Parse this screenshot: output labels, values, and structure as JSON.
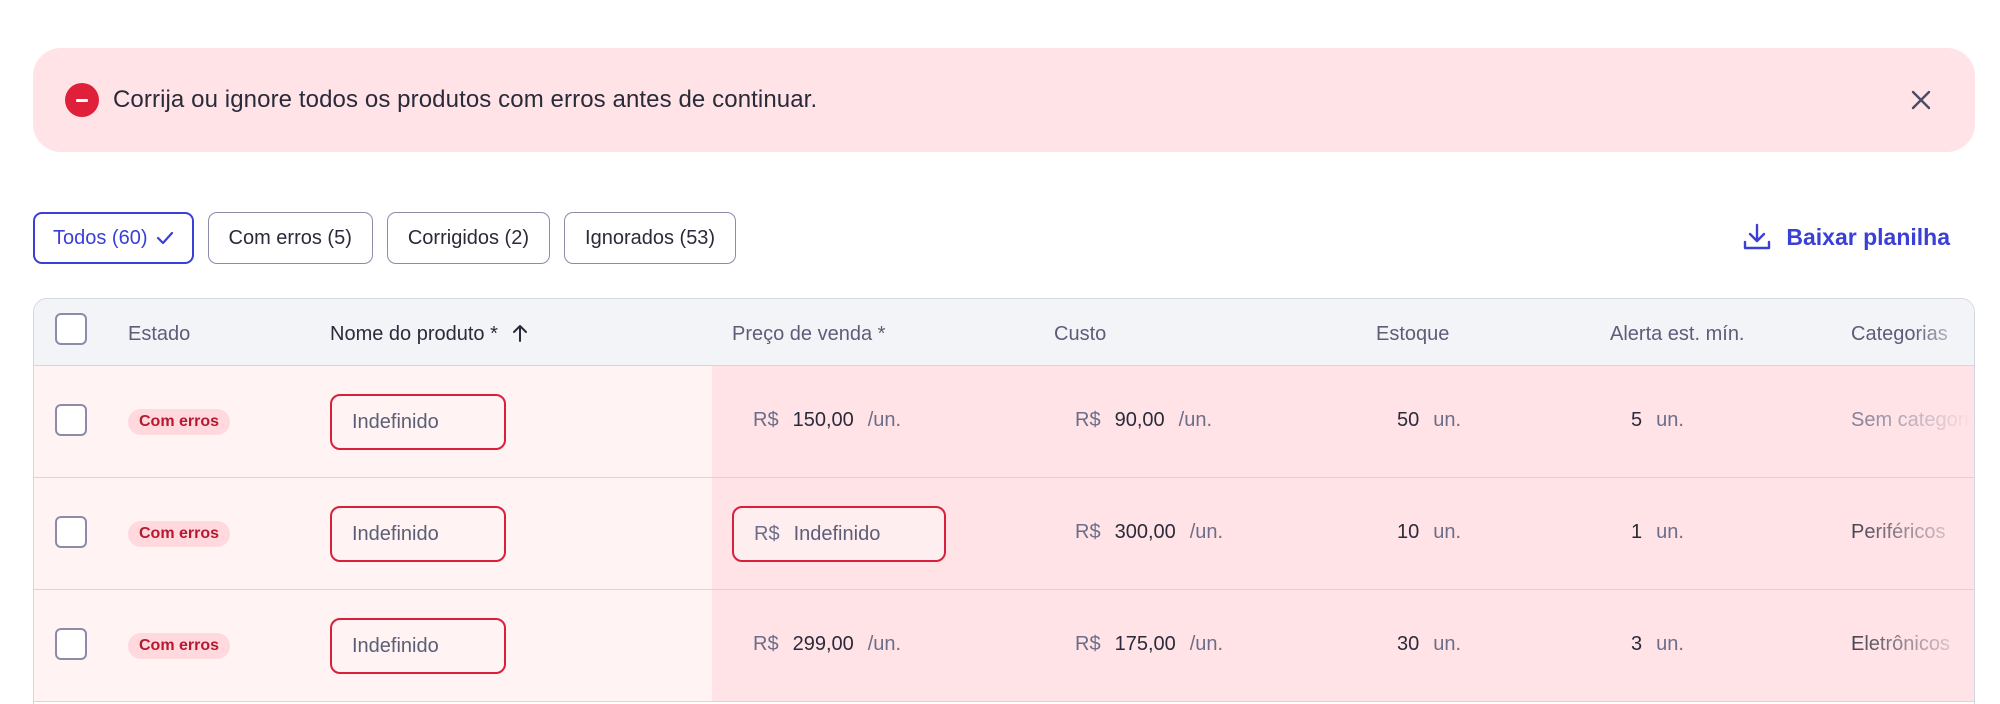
{
  "alert": {
    "message": "Corrija ou ignore todos os produtos com erros antes de continuar.",
    "icon": "error-minus-icon",
    "color": "#e0203a"
  },
  "filters": [
    {
      "label": "Todos (60)",
      "active": true
    },
    {
      "label": "Com erros (5)",
      "active": false
    },
    {
      "label": "Corrigidos (2)",
      "active": false
    },
    {
      "label": "Ignorados (53)",
      "active": false
    }
  ],
  "download": {
    "label": "Baixar planilha",
    "icon": "download-icon",
    "color": "#3a3fd6"
  },
  "table": {
    "headers": {
      "estado": "Estado",
      "nome": "Nome do produto *",
      "preco": "Preço de venda *",
      "custo": "Custo",
      "estoque": "Estoque",
      "alerta": "Alerta est. mín.",
      "categorias": "Categorias"
    },
    "currency": "R$",
    "per_unit": "/un.",
    "unit": "un.",
    "rows": [
      {
        "status": "Com erros",
        "name": "Indefinido",
        "price": "150,00",
        "price_error": false,
        "cost": "90,00",
        "stock": "50",
        "min_alert": "5",
        "category": "Sem categoria"
      },
      {
        "status": "Com erros",
        "name": "Indefinido",
        "price": "Indefinido",
        "price_error": true,
        "cost": "300,00",
        "stock": "10",
        "min_alert": "1",
        "category": "Periféricos"
      },
      {
        "status": "Com erros",
        "name": "Indefinido",
        "price": "299,00",
        "price_error": false,
        "cost": "175,00",
        "stock": "30",
        "min_alert": "3",
        "category": "Eletrônicos"
      }
    ]
  }
}
